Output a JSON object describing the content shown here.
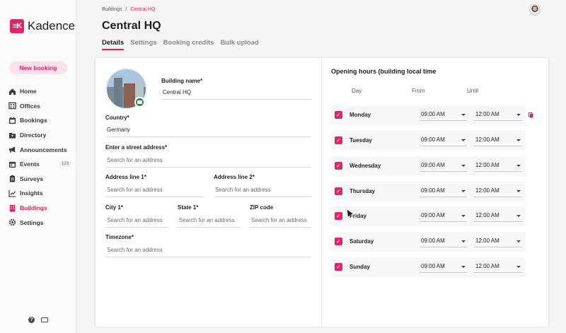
{
  "app": {
    "name": "Kadence",
    "logo_mark": "≡K"
  },
  "sidebar": {
    "new_booking": "New booking",
    "items": [
      {
        "label": "Home",
        "icon": "home-icon"
      },
      {
        "label": "Offices",
        "icon": "offices-icon"
      },
      {
        "label": "Bookings",
        "icon": "bookings-icon"
      },
      {
        "label": "Directory",
        "icon": "directory-icon"
      },
      {
        "label": "Announcements",
        "icon": "megaphone-icon"
      },
      {
        "label": "Events",
        "icon": "calendar-icon",
        "badge": "123"
      },
      {
        "label": "Surveys",
        "icon": "clipboard-icon"
      },
      {
        "label": "Insights",
        "icon": "chart-icon"
      },
      {
        "label": "Buildings",
        "icon": "building-icon",
        "active": true
      },
      {
        "label": "Settings",
        "icon": "gear-icon"
      }
    ],
    "help_glyph": "?"
  },
  "breadcrumb": {
    "parent": "Buildings",
    "sep": "/",
    "current": "Central HQ"
  },
  "page": {
    "title": "Central HQ"
  },
  "tabs": [
    "Details",
    "Settings",
    "Booking credits",
    "Bulk upload"
  ],
  "form": {
    "building_name": {
      "label": "Building name*",
      "value": "Central HQ"
    },
    "country": {
      "label": "Country*",
      "value": "Germany"
    },
    "street": {
      "label": "Enter a street address*",
      "placeholder": "Search for an address"
    },
    "address1": {
      "label": "Address line 1*",
      "placeholder": "Search for an address"
    },
    "address2": {
      "label": "Address line 2*",
      "placeholder": "Search for an address"
    },
    "city": {
      "label": "City 1*",
      "placeholder": "Search for an address"
    },
    "state": {
      "label": "State 1*",
      "placeholder": "Search for an address"
    },
    "zip": {
      "label": "ZIP code",
      "placeholder": "Search for an address"
    },
    "timezone": {
      "label": "Timezone*",
      "placeholder": "Search for an address"
    }
  },
  "hours": {
    "title": "Opening hours (building local time",
    "col_day": "Day",
    "col_from": "From",
    "col_until": "Until",
    "days": [
      {
        "day": "Monday",
        "from": "09:00 AM",
        "until": "12:00 AM"
      },
      {
        "day": "Tuesday",
        "from": "09:00 AM",
        "until": "12:00 AM"
      },
      {
        "day": "Wednesday",
        "from": "09:00 AM",
        "until": "12:00 AM"
      },
      {
        "day": "Thursday",
        "from": "09:00 AM",
        "until": "12:00 AM"
      },
      {
        "day": "Friday",
        "from": "09:00 AM",
        "until": "12:00 AM"
      },
      {
        "day": "Saturday",
        "from": "09:00 AM",
        "until": "12:00 AM"
      },
      {
        "day": "Sunday",
        "from": "09:00 AM",
        "until": "12:00 AM"
      }
    ],
    "check_glyph": "✓"
  },
  "colors": {
    "accent": "#e0246c",
    "accent_light": "#fbe1ec",
    "success": "#1e8a47"
  }
}
